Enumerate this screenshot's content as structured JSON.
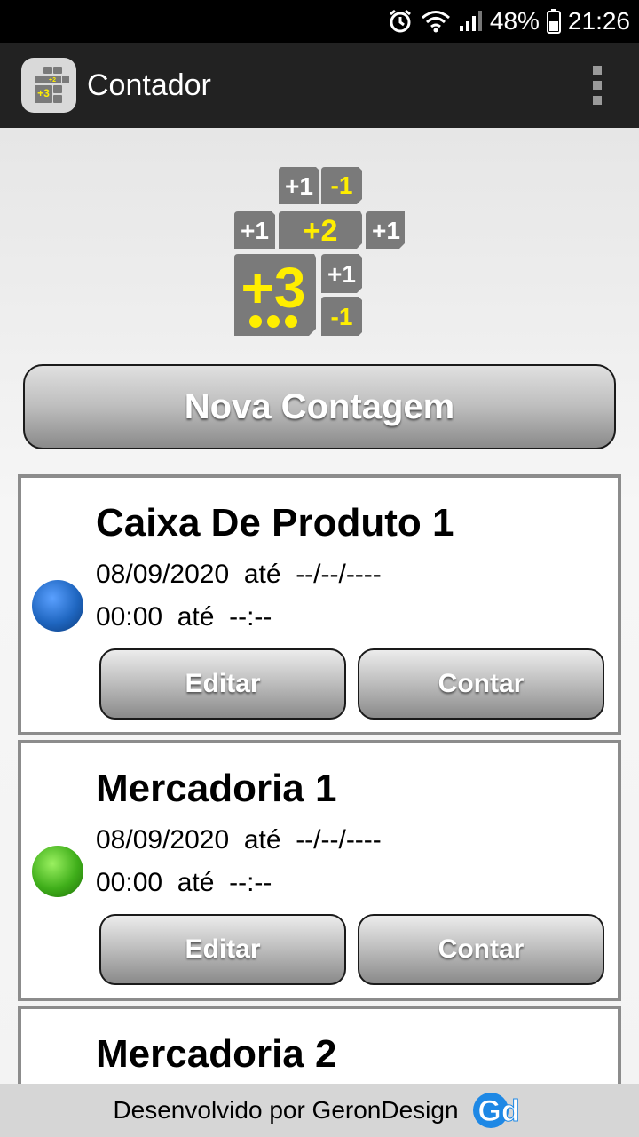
{
  "status_bar": {
    "icons": [
      "alarm-icon",
      "wifi-icon",
      "signal-icon",
      "battery-icon"
    ],
    "battery": "48%",
    "time": "21:26"
  },
  "app_bar": {
    "title": "Contador",
    "menu_icon": "overflow-menu-icon"
  },
  "logo": {
    "tiles": [
      "+1",
      "-1",
      "+1",
      "+2",
      "+1",
      "+3",
      "+1",
      "-1"
    ]
  },
  "new_count_button": "Nova Contagem",
  "counts": [
    {
      "name": "Caixa De Produto 1",
      "date_line": "08/09/2020  até  --/--/----",
      "time_line": "00:00  até  --:--",
      "indicator_color": "#1f66c0",
      "edit_label": "Editar",
      "count_label": "Contar"
    },
    {
      "name": "Mercadoria 1",
      "date_line": "08/09/2020  até  --/--/----",
      "time_line": "00:00  até  --:--",
      "indicator_color": "#3fae1a",
      "edit_label": "Editar",
      "count_label": "Contar"
    },
    {
      "name": "Mercadoria 2"
    }
  ],
  "footer": {
    "credit": "Desenvolvido por GeronDesign",
    "logo_text": "Gd"
  },
  "colors": {
    "app_bar": "#222222",
    "status_bar": "#000000",
    "tile_gray": "#7a7a7a",
    "tile_yellow": "#ffee00",
    "card_border": "#8c8c8c"
  }
}
